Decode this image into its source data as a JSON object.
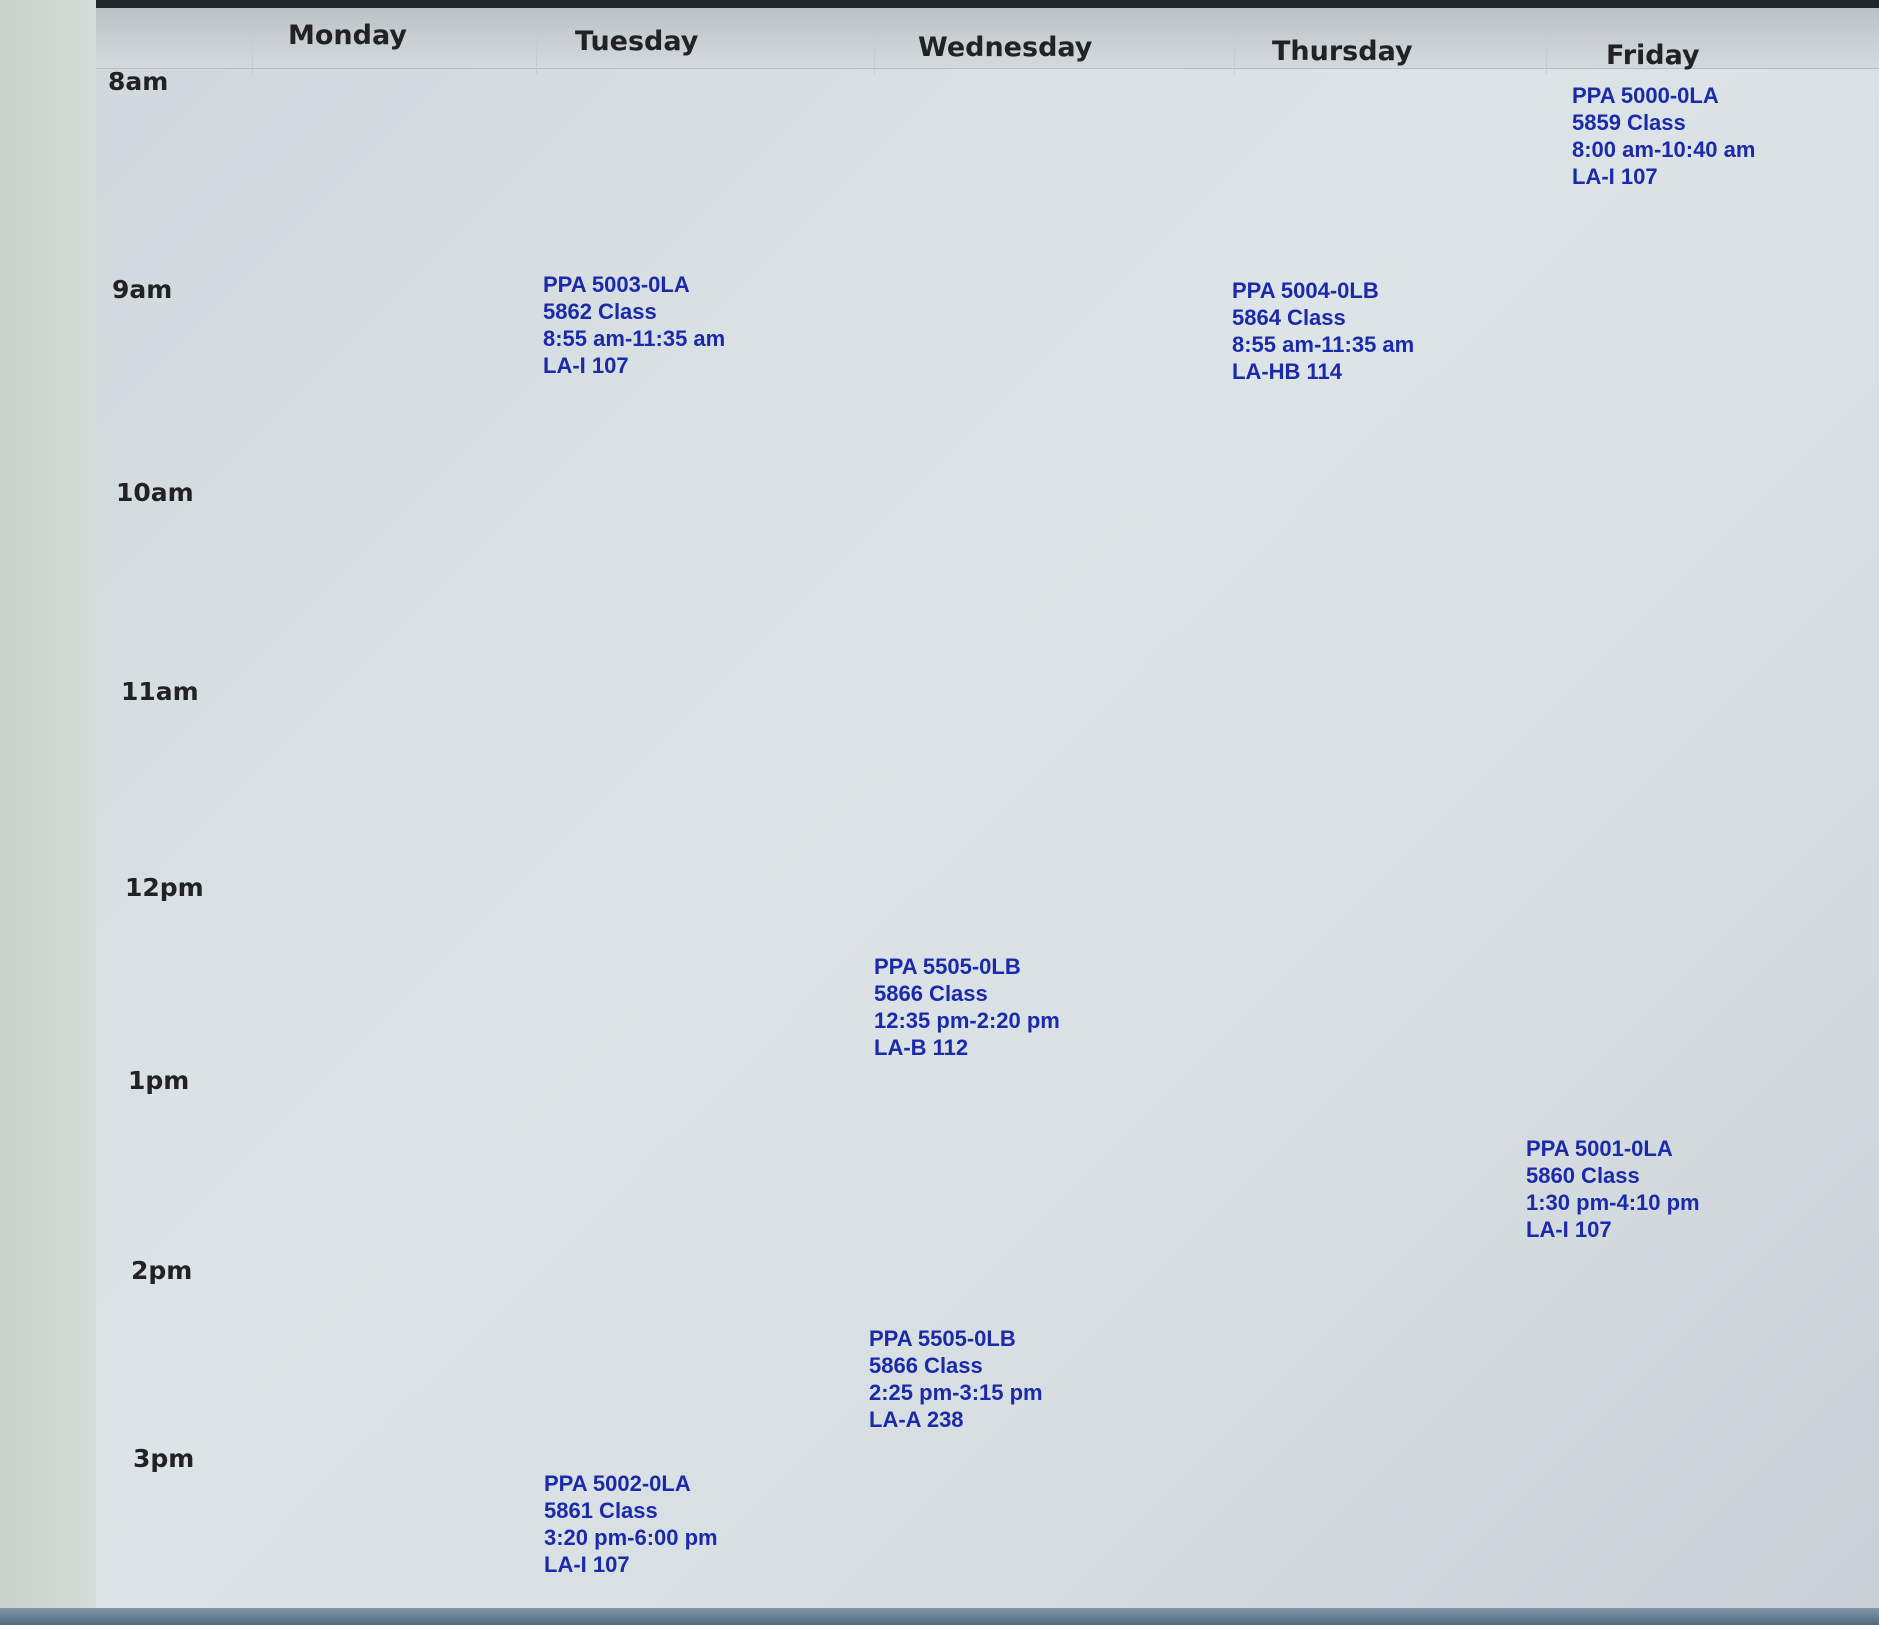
{
  "days": [
    "Monday",
    "Tuesday",
    "Wednesday",
    "Thursday",
    "Friday"
  ],
  "hours": [
    "8am",
    "9am",
    "10am",
    "11am",
    "12pm",
    "1pm",
    "2pm",
    "3pm"
  ],
  "events": [
    {
      "day": "Friday",
      "course": "PPA 5000-0LA",
      "crn": "5859 Class",
      "time": "8:00 am-10:40 am",
      "room": "LA-I 107"
    },
    {
      "day": "Tuesday",
      "course": "PPA 5003-0LA",
      "crn": "5862 Class",
      "time": "8:55 am-11:35 am",
      "room": "LA-I 107"
    },
    {
      "day": "Thursday",
      "course": "PPA 5004-0LB",
      "crn": "5864 Class",
      "time": "8:55 am-11:35 am",
      "room": "LA-HB 114"
    },
    {
      "day": "Wednesday",
      "course": "PPA 5505-0LB",
      "crn": "5866 Class",
      "time": "12:35 pm-2:20 pm",
      "room": "LA-B 112"
    },
    {
      "day": "Friday",
      "course": "PPA 5001-0LA",
      "crn": "5860 Class",
      "time": "1:30 pm-4:10 pm",
      "room": "LA-I 107"
    },
    {
      "day": "Wednesday",
      "course": "PPA 5505-0LB",
      "crn": "5866 Class",
      "time": "2:25 pm-3:15 pm",
      "room": "LA-A 238"
    },
    {
      "day": "Tuesday",
      "course": "PPA 5002-0LA",
      "crn": "5861 Class",
      "time": "3:20 pm-6:00 pm",
      "room": "LA-I 107"
    }
  ],
  "colors": {
    "event_text": "#1a2aa8",
    "label_text": "#222222",
    "background": "#d8dfe2"
  }
}
